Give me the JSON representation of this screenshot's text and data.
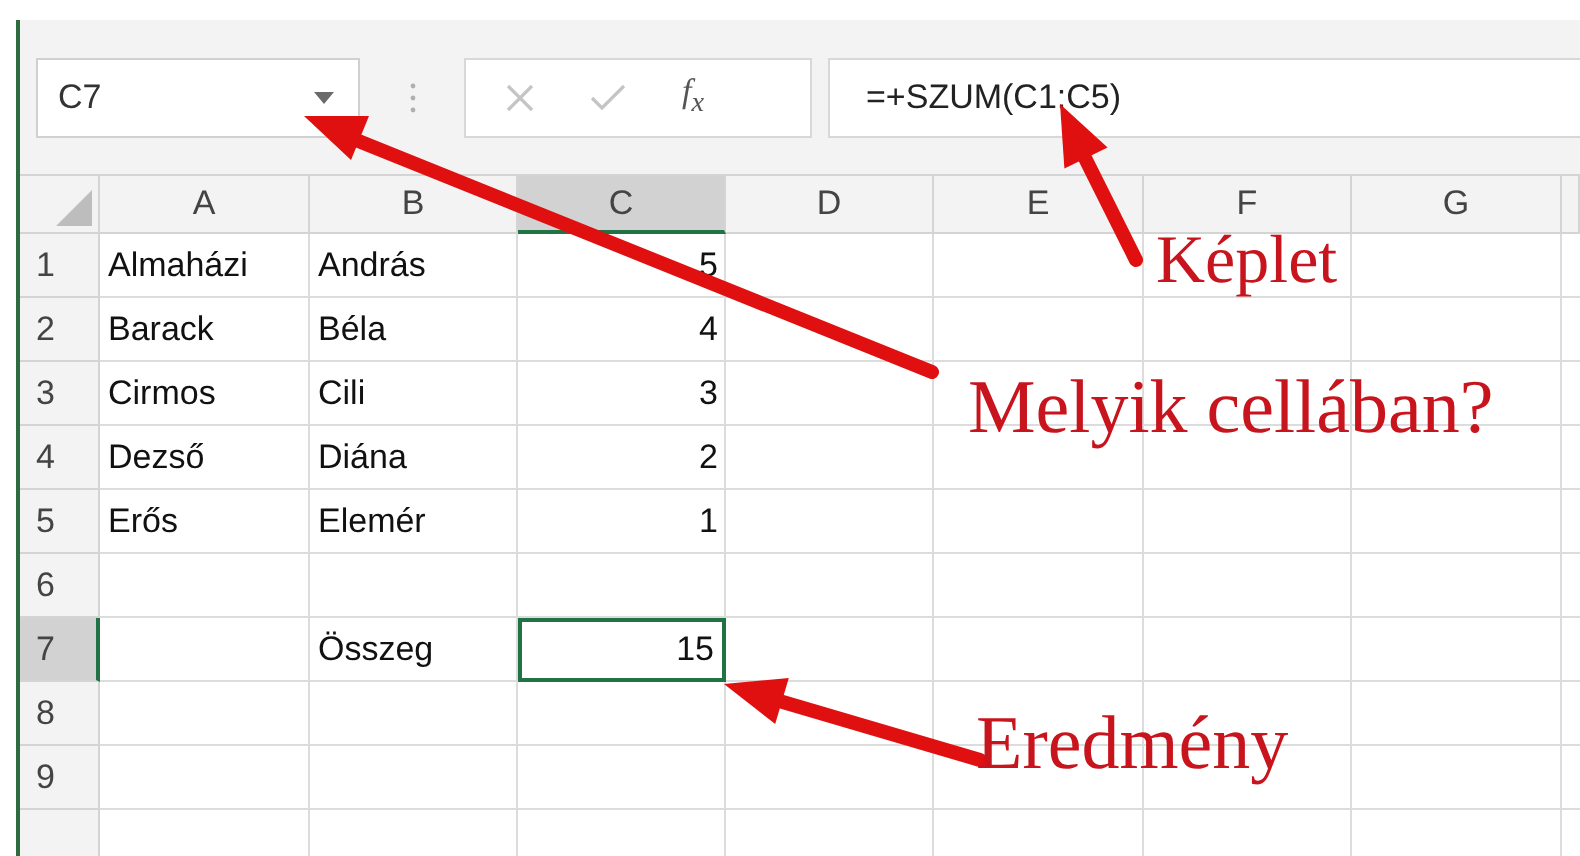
{
  "formula_bar": {
    "name_box": "C7",
    "function_label": "f$_{x}$",
    "formula": "=+SZUM(C1:C5)"
  },
  "columns": [
    {
      "label": "A",
      "selected": false
    },
    {
      "label": "B",
      "selected": false
    },
    {
      "label": "C",
      "selected": true
    },
    {
      "label": "D",
      "selected": false
    },
    {
      "label": "E",
      "selected": false
    },
    {
      "label": "F",
      "selected": false
    },
    {
      "label": "G",
      "selected": false
    }
  ],
  "rows": [
    {
      "number": "1",
      "selected": false,
      "cells": [
        {
          "text": "Almaházi",
          "kind": "text"
        },
        {
          "text": "András",
          "kind": "text"
        },
        {
          "text": "5",
          "kind": "number"
        }
      ]
    },
    {
      "number": "2",
      "selected": false,
      "cells": [
        {
          "text": "Barack",
          "kind": "text"
        },
        {
          "text": "Béla",
          "kind": "text"
        },
        {
          "text": "4",
          "kind": "number"
        }
      ]
    },
    {
      "number": "3",
      "selected": false,
      "cells": [
        {
          "text": "Cirmos",
          "kind": "text"
        },
        {
          "text": "Cili",
          "kind": "text"
        },
        {
          "text": "3",
          "kind": "number"
        }
      ]
    },
    {
      "number": "4",
      "selected": false,
      "cells": [
        {
          "text": "Dezső",
          "kind": "text"
        },
        {
          "text": "Diána",
          "kind": "text"
        },
        {
          "text": "2",
          "kind": "number"
        }
      ]
    },
    {
      "number": "5",
      "selected": false,
      "cells": [
        {
          "text": "Erős",
          "kind": "text"
        },
        {
          "text": "Elemér",
          "kind": "text"
        },
        {
          "text": "1",
          "kind": "number"
        }
      ]
    },
    {
      "number": "6",
      "selected": false,
      "cells": []
    },
    {
      "number": "7",
      "selected": true,
      "cells": [
        {
          "kind": "empty"
        },
        {
          "text": "Összeg",
          "kind": "text"
        },
        {
          "text": "15",
          "kind": "number"
        }
      ]
    },
    {
      "number": "8",
      "selected": false,
      "cells": []
    },
    {
      "number": "9",
      "selected": false,
      "cells": []
    }
  ],
  "annotations": [
    {
      "text": "Képlet"
    },
    {
      "text": "Melyik cellában?"
    },
    {
      "text": "Eredmény"
    }
  ]
}
